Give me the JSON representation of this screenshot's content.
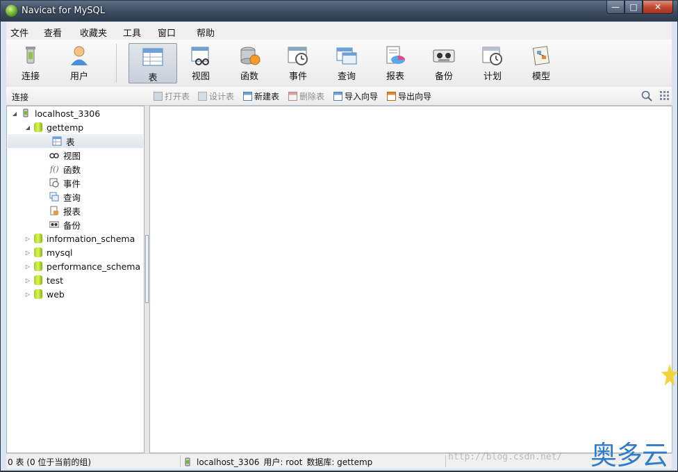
{
  "window": {
    "title": "Navicat for MySQL"
  },
  "menu": [
    "文件",
    "查看",
    "收藏夹",
    "工具",
    "窗口",
    "帮助"
  ],
  "toolbar": {
    "connect": "连接",
    "user": "用户",
    "table": "表",
    "view": "视图",
    "function": "函数",
    "event": "事件",
    "query": "查询",
    "report": "报表",
    "backup": "备份",
    "schedule": "计划",
    "model": "模型"
  },
  "subbar": {
    "connection_label": "连接",
    "open_table": "打开表",
    "design_table": "设计表",
    "new_table": "新建表",
    "delete_table": "删除表",
    "import_wizard": "导入向导",
    "export_wizard": "导出向导"
  },
  "tree": {
    "connection": "localhost_3306",
    "current_db": "gettemp",
    "children": [
      "表",
      "视图",
      "函数",
      "事件",
      "查询",
      "报表",
      "备份"
    ],
    "databases": [
      "information_schema",
      "mysql",
      "performance_schema",
      "test",
      "web"
    ]
  },
  "status": {
    "left": "0 表 (0 位于当前的组)",
    "connection": "localhost_3306",
    "user": "用户: root",
    "database": "数据库: gettemp"
  },
  "watermark": "http://blog.csdn.net/",
  "brand": "奥多云"
}
